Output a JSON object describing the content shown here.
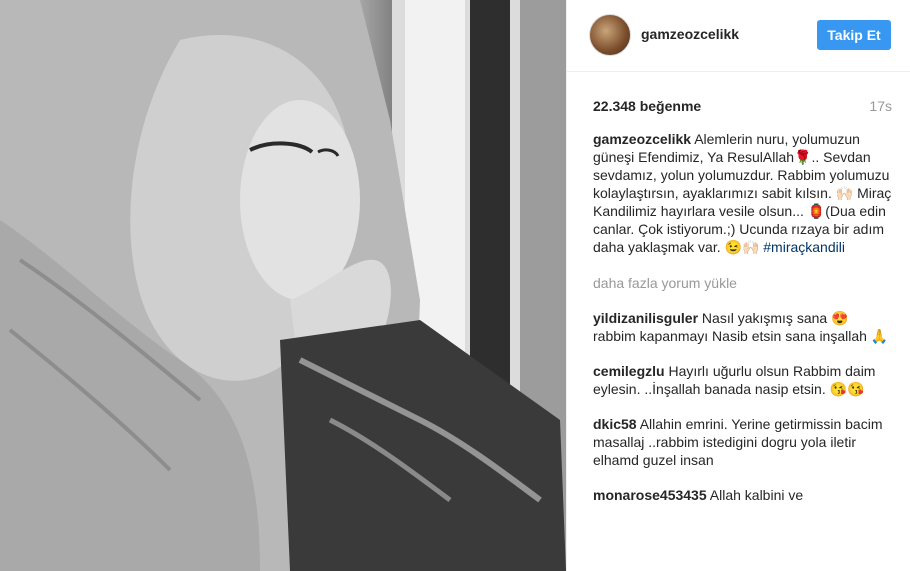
{
  "post": {
    "username": "gamzeozcelikk",
    "follow_label": "Takip Et",
    "likes": "22.348 beğenme",
    "time": "17s",
    "caption": {
      "username": "gamzeozcelikk",
      "text": "Alemlerin nuru, yolumuzun güneşi Efendimiz, Ya ResulAllah🌹.. Sevdan sevdamız, yolun yolumuzdur. Rabbim yolumuzu kolaylaştırsın, ayaklarımızı sabit kılsın. 🙌🏻 Miraç Kandilimiz hayırlara vesile olsun... 🏮(Dua edin canlar. Çok istiyorum.;) Ucunda rızaya bir adım daha yaklaşmak var. 😉🙌🏻",
      "hashtag": "#miraçkandili"
    },
    "load_more": "daha fazla yorum yükle",
    "comments": [
      {
        "username": "yildizanilisguler",
        "text": "Nasıl yakışmış sana 😍 rabbim kapanmayı Nasib etsin sana inşallah 🙏"
      },
      {
        "username": "cemilegzlu",
        "text": "Hayırlı uğurlu olsun Rabbim daim eylesin. ..İnşallah banada nasip etsin. 😘😘"
      },
      {
        "username": "dkic58",
        "text": "Allahin emrini. Yerine getirmissin bacim masallaj ..rabbim istedigini dogru yola iletir elhamd guzel insan"
      },
      {
        "username": "monarose453435",
        "text": "Allah kalbini ve"
      }
    ]
  }
}
